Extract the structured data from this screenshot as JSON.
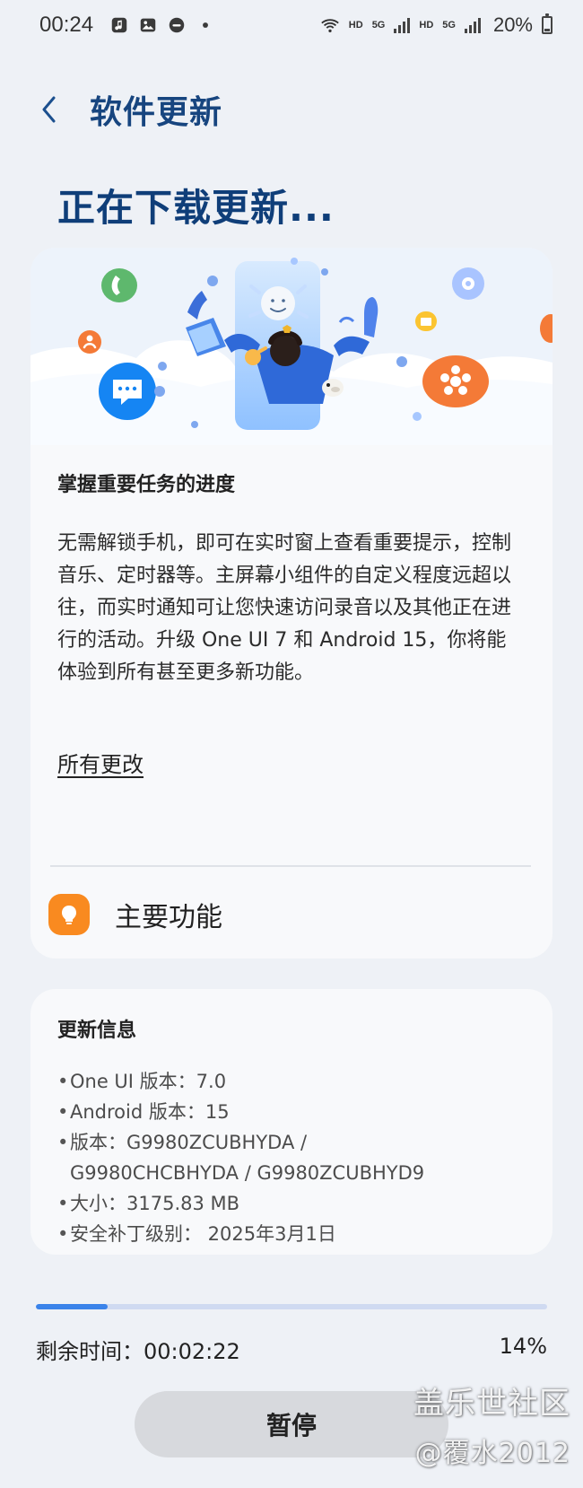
{
  "status_bar": {
    "time": "00:24",
    "battery": "20%",
    "network_label_1": "HD",
    "network_label_2": "HD",
    "network_type_1": "5G",
    "network_type_2": "5G"
  },
  "header": {
    "title": "软件更新"
  },
  "main": {
    "title": "正在下载更新..."
  },
  "feature_card": {
    "section_title": "掌握重要任务的进度",
    "description": "无需解锁手机，即可在实时窗上查看重要提示，控制音乐、定时器等。主屏幕小组件的自定义程度远超以往，而实时通知可让您快速访问录音以及其他正在进行的活动。升级 One UI 7 和 Android 15，你将能体验到所有甚至更多新功能。",
    "all_changes": "所有更改",
    "main_features": "主要功能",
    "accent": "#f98a20"
  },
  "update_info": {
    "title": "更新信息",
    "one_ui_version": "One UI 版本：7.0",
    "android_version": "Android 版本：15",
    "version_line_1": "版本：G9980ZCUBHYDA /",
    "version_line_2": "G9980CHCBHYDA / G9980ZCUBHYD9",
    "size": "大小：3175.83 MB",
    "security_patch": "安全补丁级别： 2025年3月1日"
  },
  "download": {
    "progress": 0.14,
    "remaining_label": "剩余时间：00:02:22",
    "percent_label": "14%",
    "pause_label": "暂停",
    "progress_color": "#3a83ea",
    "track_color": "#cfdaf1"
  },
  "watermark": {
    "line_1": "盖乐世社区",
    "line_2": "@覆水2012"
  },
  "icons": {
    "back": "chevron-left-icon",
    "feature": "lightbulb-icon"
  }
}
